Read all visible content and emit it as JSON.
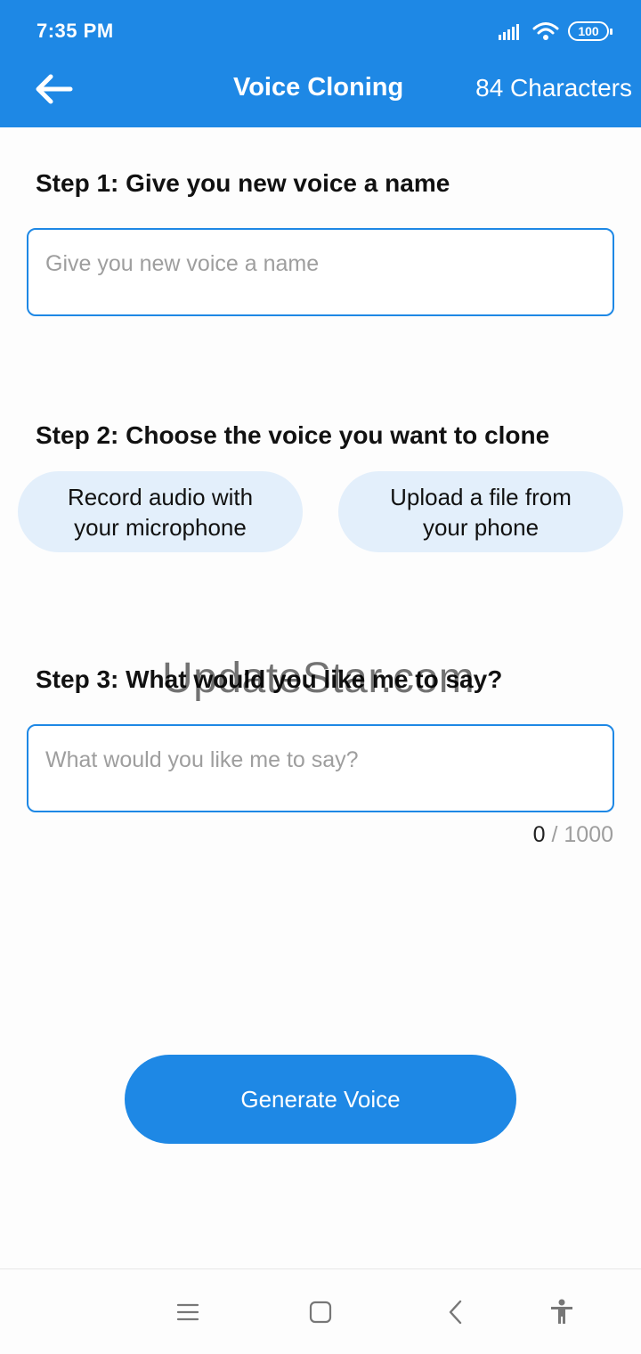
{
  "status_bar": {
    "time": "7:35 PM",
    "battery": "100"
  },
  "app_bar": {
    "title": "Voice Cloning",
    "characters": "84 Characters"
  },
  "step1": {
    "title": "Step 1: Give you new voice a name",
    "placeholder": "Give you new voice a name",
    "value": ""
  },
  "step2": {
    "title": "Step 2: Choose the voice you want to clone",
    "record_button": "Record audio with your microphone",
    "upload_button": "Upload a file from your phone"
  },
  "step3": {
    "title": "Step 3: What would you like me to say?",
    "placeholder": "What would you like me to say?",
    "value": "",
    "count_current": "0",
    "count_max": " / 1000"
  },
  "generate_button": "Generate Voice",
  "watermark": "UpdateStar.com",
  "colors": {
    "primary": "#1e88e5",
    "pill_bg": "#e3effb",
    "placeholder": "#9e9e9e"
  },
  "icons": {
    "back": "arrow-left-icon",
    "signal": "signal-icon",
    "wifi": "wifi-icon",
    "battery": "battery-icon",
    "nav_menu": "menu-icon",
    "nav_home": "home-icon",
    "nav_back": "chevron-left-icon",
    "nav_accessibility": "accessibility-icon"
  }
}
